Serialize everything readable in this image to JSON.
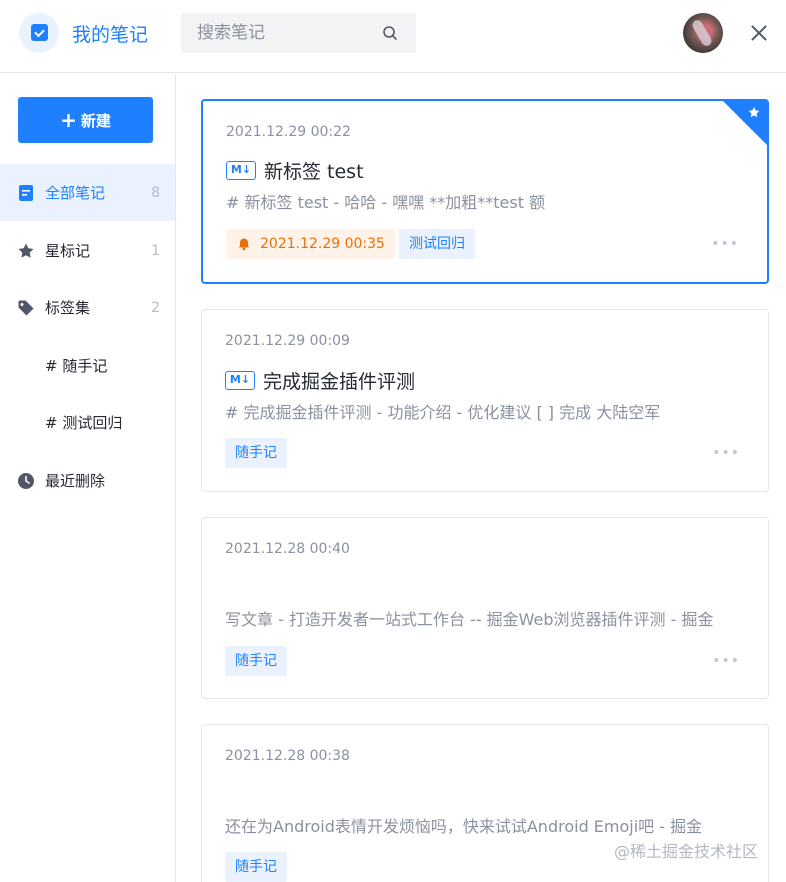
{
  "header": {
    "app_title": "我的笔记",
    "search_placeholder": "搜索笔记"
  },
  "sidebar": {
    "new_label": "新建",
    "items": [
      {
        "label": "全部笔记",
        "count": "8"
      },
      {
        "label": "星标记",
        "count": "1"
      },
      {
        "label": "标签集",
        "count": "2"
      },
      {
        "label": "# 随手记",
        "count": ""
      },
      {
        "label": "# 测试回归",
        "count": ""
      },
      {
        "label": "最近删除",
        "count": ""
      }
    ]
  },
  "notes": [
    {
      "date": "2021.12.29 00:22",
      "badge": "M↓",
      "title": "新标签 test",
      "excerpt": "# 新标签 test - 哈哈 - 嘿嘿 **加粗**test 额",
      "reminder": "2021.12.29 00:35",
      "tag": "测试回归",
      "starred": true,
      "more": "•••"
    },
    {
      "date": "2021.12.29 00:09",
      "badge": "M↓",
      "title": "完成掘金插件评测",
      "excerpt": "# 完成掘金插件评测 - 功能介绍 - 优化建议 [ ] 完成 大陆空军",
      "tag": "随手记",
      "more": "•••"
    },
    {
      "date": "2021.12.28 00:40",
      "excerpt": "写文章 - 打造开发者一站式工作台 -- 掘金Web浏览器插件评测 - 掘金",
      "tag": "随手记",
      "more": "•••"
    },
    {
      "date": "2021.12.28 00:38",
      "excerpt": "还在为Android表情开发烦恼吗，快来试试Android Emoji吧 - 掘金",
      "tag": "随手记",
      "more": "•••"
    }
  ],
  "watermark": "@稀土掘金技术社区",
  "colors": {
    "accent": "#1e80ff",
    "reminder": "#e8710a",
    "muted": "#8a919f"
  }
}
